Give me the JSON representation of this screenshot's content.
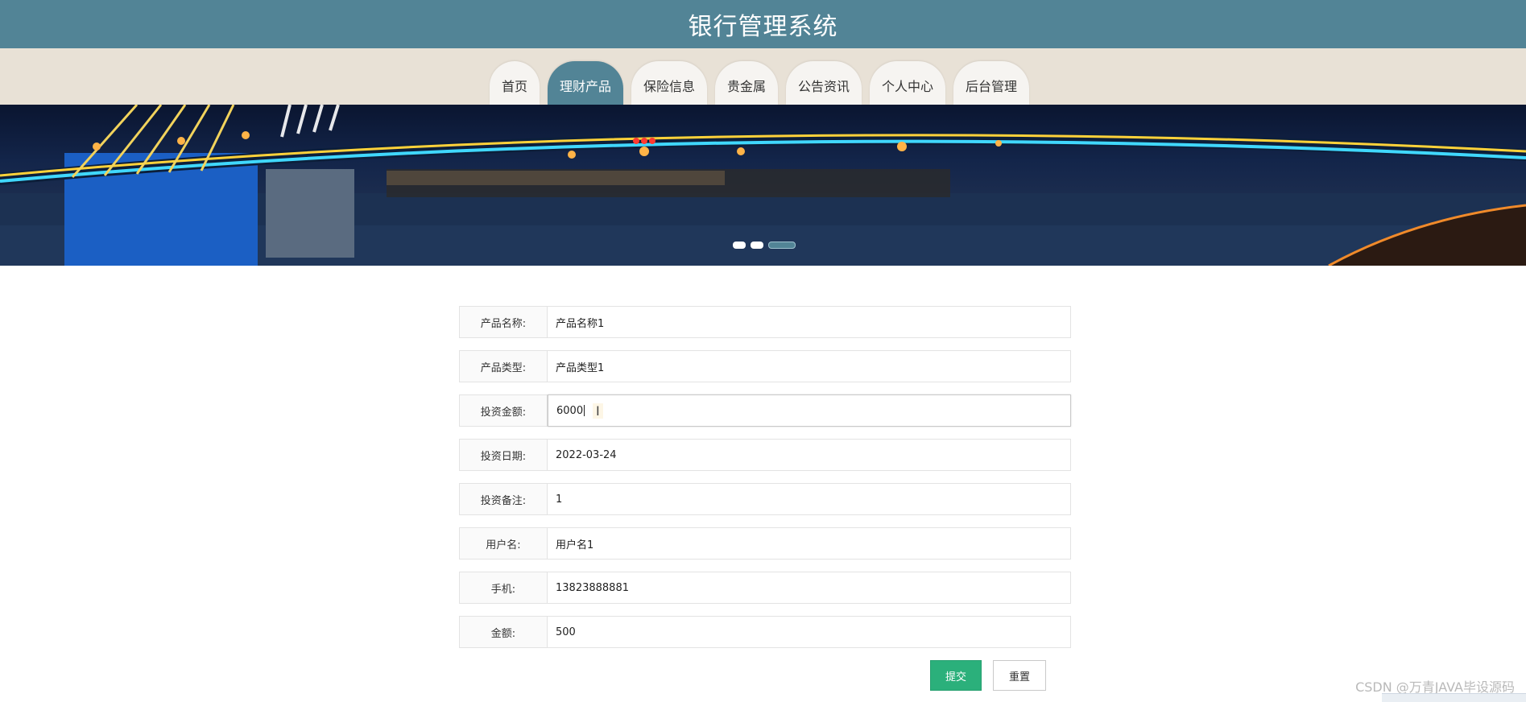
{
  "header": {
    "title": "银行管理系统"
  },
  "nav": {
    "items": [
      {
        "label": "首页",
        "active": false
      },
      {
        "label": "理财产品",
        "active": true
      },
      {
        "label": "保险信息",
        "active": false
      },
      {
        "label": "贵金属",
        "active": false
      },
      {
        "label": "公告资讯",
        "active": false
      },
      {
        "label": "个人中心",
        "active": false
      },
      {
        "label": "后台管理",
        "active": false
      }
    ]
  },
  "banner": {
    "slides": 3,
    "active_slide": 3
  },
  "form": {
    "fields": [
      {
        "label": "产品名称:",
        "value": "产品名称1"
      },
      {
        "label": "产品类型:",
        "value": "产品类型1"
      },
      {
        "label": "投资金额:",
        "value": "6000"
      },
      {
        "label": "投资日期:",
        "value": "2022-03-24"
      },
      {
        "label": "投资备注:",
        "value": "1"
      },
      {
        "label": "用户名:",
        "value": "用户名1"
      },
      {
        "label": "手机:",
        "value": "13823888881"
      },
      {
        "label": "金额:",
        "value": "500"
      }
    ],
    "focused_field": "投资金额:",
    "submit_label": "提交",
    "reset_label": "重置"
  },
  "watermark": "CSDN @万青JAVA毕设源码",
  "colors": {
    "primary": "#528496",
    "submit": "#2bb07b",
    "nav_bg": "#e8e1d6"
  }
}
